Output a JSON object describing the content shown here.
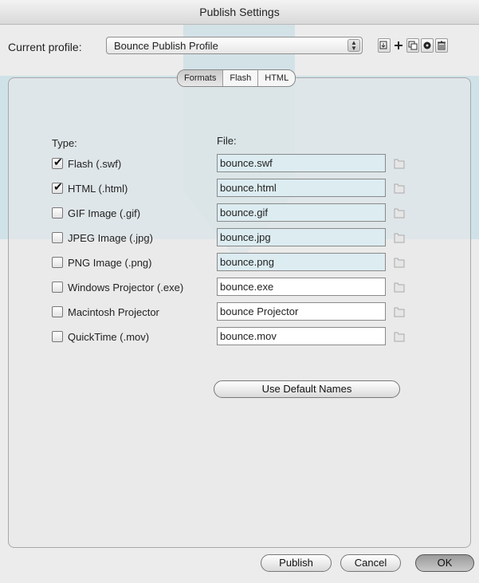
{
  "window": {
    "title": "Publish Settings"
  },
  "profile": {
    "label": "Current profile:",
    "value": "Bounce Publish Profile"
  },
  "toolbar_icons": [
    "import-export-icon",
    "add-profile-icon",
    "duplicate-profile-icon",
    "profile-settings-icon",
    "delete-profile-icon"
  ],
  "tabs": [
    {
      "label": "Formats",
      "selected": true
    },
    {
      "label": "Flash",
      "selected": false
    },
    {
      "label": "HTML",
      "selected": false
    }
  ],
  "headers": {
    "type": "Type:",
    "file": "File:"
  },
  "formats": [
    {
      "label": "Flash  (.swf)",
      "checked": true,
      "file": "bounce.swf"
    },
    {
      "label": "HTML (.html)",
      "checked": true,
      "file": "bounce.html"
    },
    {
      "label": "GIF Image (.gif)",
      "checked": false,
      "file": "bounce.gif"
    },
    {
      "label": "JPEG Image (.jpg)",
      "checked": false,
      "file": "bounce.jpg"
    },
    {
      "label": "PNG Image (.png)",
      "checked": false,
      "file": "bounce.png"
    },
    {
      "label": "Windows Projector (.exe)",
      "checked": false,
      "file": "bounce.exe"
    },
    {
      "label": "Macintosh Projector",
      "checked": false,
      "file": "bounce Projector"
    },
    {
      "label": "QuickTime (.mov)",
      "checked": false,
      "file": "bounce.mov"
    }
  ],
  "buttons": {
    "use_default_names": "Use Default Names",
    "publish": "Publish",
    "cancel": "Cancel",
    "ok": "OK"
  },
  "colors": {
    "watermark": "#c3dde6",
    "field_tint": "#dcecf1"
  }
}
